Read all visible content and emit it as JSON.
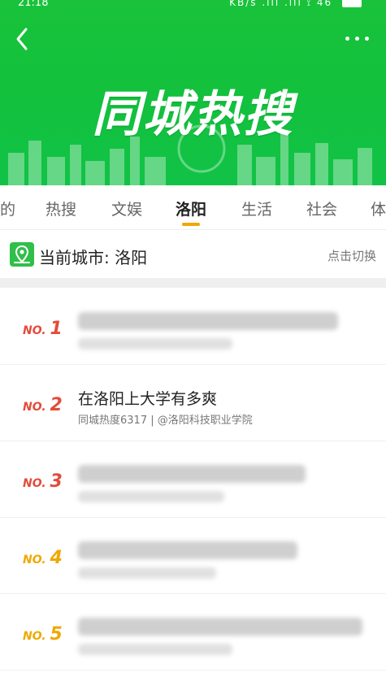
{
  "status_bar": {
    "time": "21:18",
    "right_text": "KB/s  .ıll .ıll  ⟟  46"
  },
  "header": {
    "title": "同城热搜",
    "colors": {
      "bg": "#12c13d",
      "text": "#ffffff"
    }
  },
  "tabs": [
    {
      "label": "的"
    },
    {
      "label": "热搜"
    },
    {
      "label": "文娱"
    },
    {
      "label": "洛阳",
      "active": true
    },
    {
      "label": "生活"
    },
    {
      "label": "社会"
    },
    {
      "label": "体"
    }
  ],
  "city_bar": {
    "label": "当前城市: 洛阳",
    "switch_label": "点击切换"
  },
  "list": {
    "items": [
      {
        "rank_prefix": "NO.",
        "rank_num": "1",
        "rank_color": "#e34c3a",
        "title": "",
        "meta": "",
        "blurred": true
      },
      {
        "rank_prefix": "NO.",
        "rank_num": "2",
        "rank_color": "#e34c3a",
        "title": "在洛阳上大学有多爽",
        "meta": "同城热度6317 | @洛阳科技职业学院",
        "blurred": false
      },
      {
        "rank_prefix": "NO.",
        "rank_num": "3",
        "rank_color": "#e34c3a",
        "title": "",
        "meta": "",
        "blurred": true
      },
      {
        "rank_prefix": "NO.",
        "rank_num": "4",
        "rank_color": "#f0a800",
        "title": "",
        "meta": "",
        "blurred": true
      },
      {
        "rank_prefix": "NO.",
        "rank_num": "5",
        "rank_color": "#f0a800",
        "title": "",
        "meta": "",
        "blurred": true
      }
    ]
  }
}
